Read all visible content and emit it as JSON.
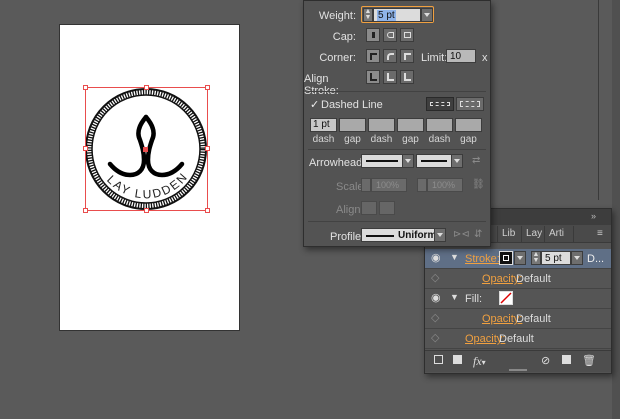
{
  "artboard": {
    "logo_text": "LAY LUDDEN"
  },
  "stroke_panel": {
    "weight_label": "Weight:",
    "weight_value": "5 pt",
    "cap_label": "Cap:",
    "corner_label": "Corner:",
    "limit_label": "Limit:",
    "limit_value": "10",
    "limit_unit": "x",
    "align_stroke_label": "Align Stroke:",
    "dashed_line_label": "Dashed Line",
    "dashed_checked": true,
    "dash_fields": [
      {
        "value": "1 pt",
        "label": "dash"
      },
      {
        "value": "",
        "label": "gap"
      },
      {
        "value": "",
        "label": "dash"
      },
      {
        "value": "",
        "label": "gap"
      },
      {
        "value": "",
        "label": "dash"
      },
      {
        "value": "",
        "label": "gap"
      }
    ],
    "arrowheads_label": "Arrowheads:",
    "scale_label": "Scale:",
    "scale_start": "100%",
    "scale_end": "100%",
    "align_label": "Align:",
    "profile_label": "Profile:",
    "profile_value": "Uniform"
  },
  "appearance_panel": {
    "tabs": [
      "ra",
      "Lib",
      "Lay",
      "Arti"
    ],
    "rows": {
      "stroke_label": "Stroke:",
      "stroke_weight": "5 pt",
      "stroke_extra": "D...",
      "stroke_opacity_label": "Opacity:",
      "stroke_opacity_value": "Default",
      "fill_label": "Fill:",
      "fill_opacity_label": "Opacity:",
      "fill_opacity_value": "Default",
      "opacity_label": "Opacity:",
      "opacity_value": "Default"
    },
    "footer_fx": "fx"
  },
  "colors": {
    "accent_orange": "#f0a040",
    "selection_red": "#e94d4d",
    "panel_bg": "#535353",
    "canvas_bg": "#5a5a5a"
  }
}
